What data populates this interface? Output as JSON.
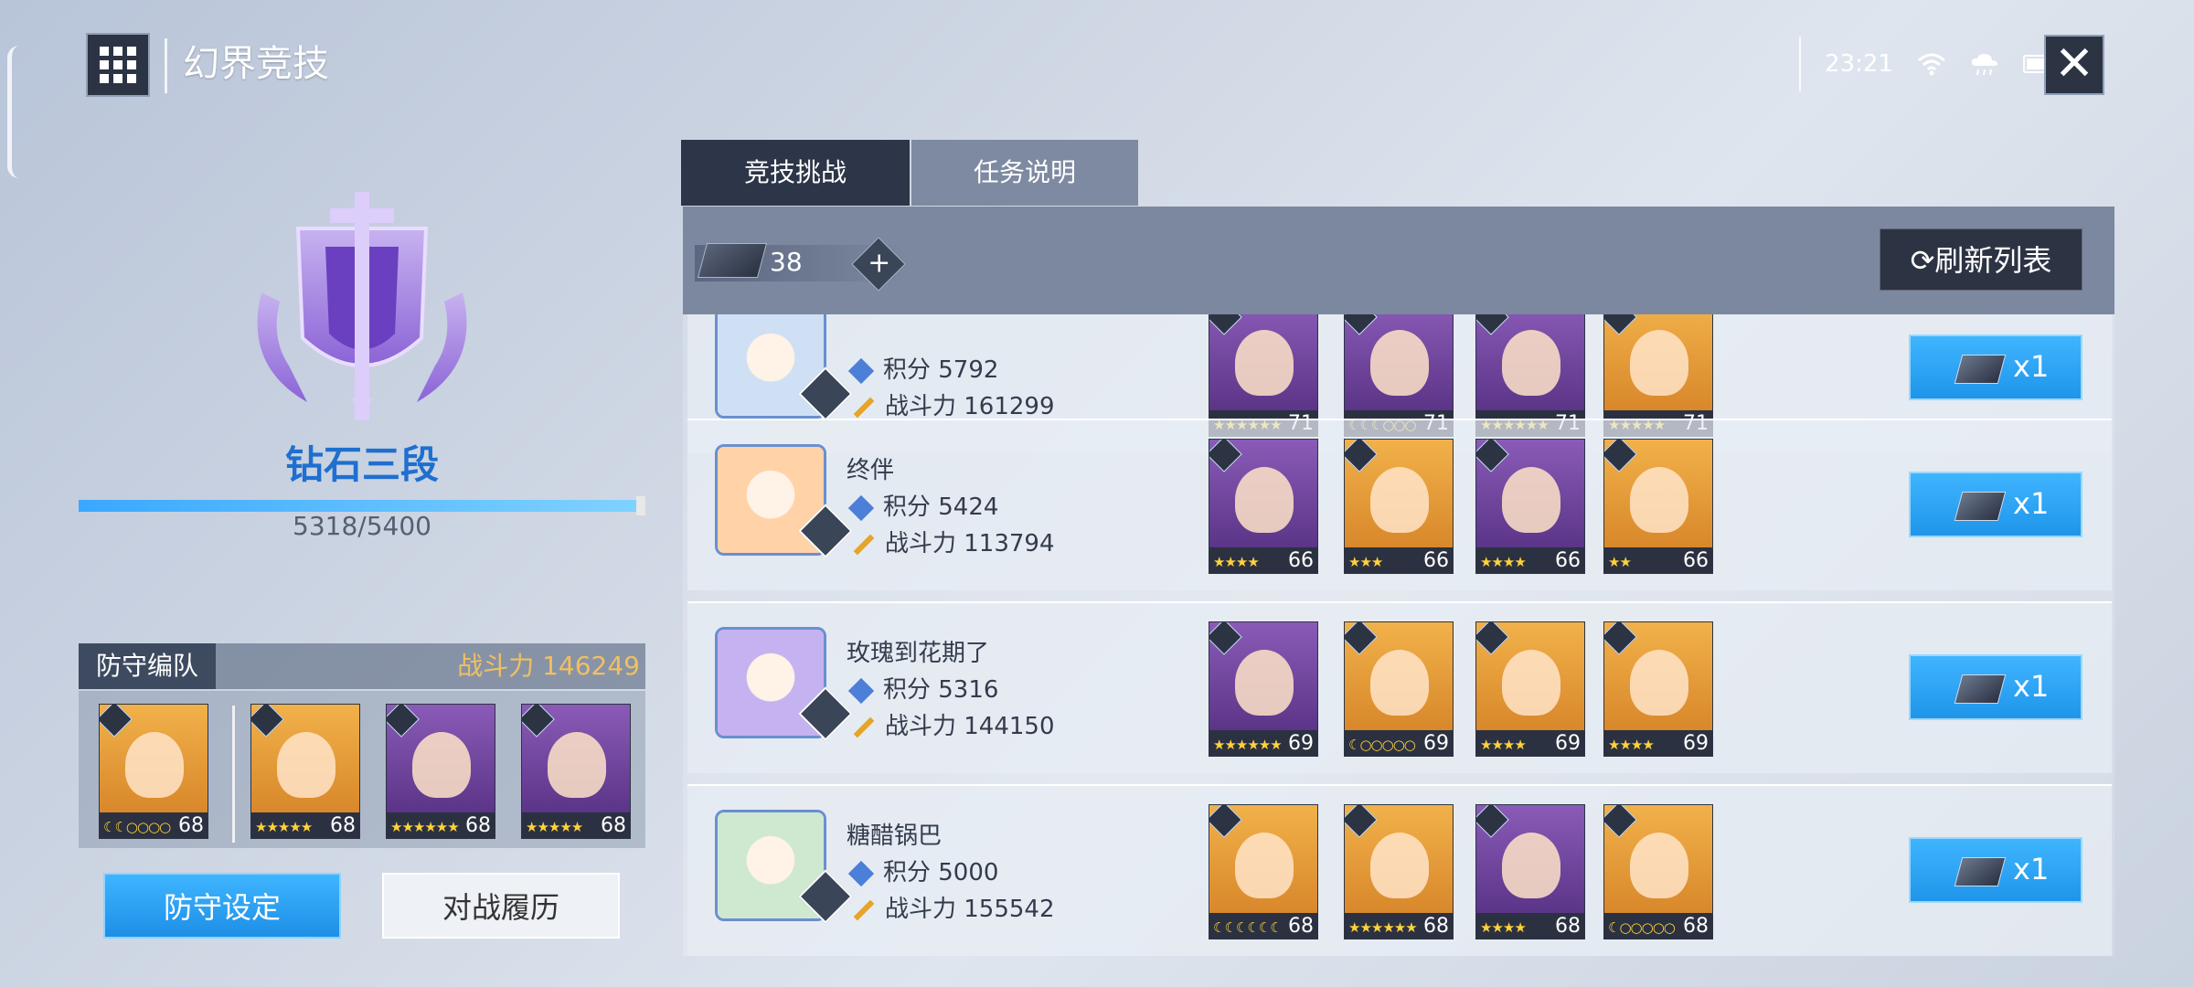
{
  "header": {
    "title": "幻界竞技",
    "time": "23:21"
  },
  "icons": {
    "menu": "grid-menu-icon",
    "close": "close-icon",
    "wifi": "wifi-icon",
    "weather": "weather-icon",
    "battery": "battery-icon"
  },
  "rank": {
    "name": "钻石三段",
    "score_text": "5318/5400",
    "progress": 0.985
  },
  "defense": {
    "title": "防守编队",
    "power_text": "战斗力 146249",
    "heroes": [
      {
        "level": "68",
        "stars": "☾☾○○○○",
        "bg": "orange"
      },
      {
        "level": "68",
        "stars": "★★★★★",
        "bg": "orange"
      },
      {
        "level": "68",
        "stars": "★★★★★★",
        "bg": "purple"
      },
      {
        "level": "68",
        "stars": "★★★★★",
        "bg": "purple"
      }
    ]
  },
  "buttons": {
    "defense_setup": "防守设定",
    "battle_history": "对战履历",
    "refresh": "刷新列表"
  },
  "tabs": [
    {
      "label": "竞技挑战",
      "active": true
    },
    {
      "label": "任务说明",
      "active": false
    }
  ],
  "tickets": {
    "count": "38",
    "plus": "+"
  },
  "opponents": [
    {
      "name": "",
      "score": "积分 5792",
      "power": "战斗力 161299",
      "reward": "x1",
      "heroes": [
        {
          "level": "71",
          "stars": "★★★★★★",
          "bg": "purple"
        },
        {
          "level": "71",
          "stars": "☾☾☾○○○",
          "bg": "purple"
        },
        {
          "level": "71",
          "stars": "★★★★★★",
          "bg": "purple"
        },
        {
          "level": "71",
          "stars": "★★★★★",
          "bg": "orange"
        }
      ]
    },
    {
      "name": "终伴",
      "score": "积分 5424",
      "power": "战斗力 113794",
      "reward": "x1",
      "heroes": [
        {
          "level": "66",
          "stars": "★★★★",
          "bg": "purple"
        },
        {
          "level": "66",
          "stars": "★★★",
          "bg": "orange"
        },
        {
          "level": "66",
          "stars": "★★★★",
          "bg": "purple"
        },
        {
          "level": "66",
          "stars": "★★",
          "bg": "orange"
        }
      ]
    },
    {
      "name": "玫瑰到花期了",
      "score": "积分 5316",
      "power": "战斗力 144150",
      "reward": "x1",
      "heroes": [
        {
          "level": "69",
          "stars": "★★★★★★",
          "bg": "purple"
        },
        {
          "level": "69",
          "stars": "☾○○○○○",
          "bg": "orange"
        },
        {
          "level": "69",
          "stars": "★★★★",
          "bg": "orange"
        },
        {
          "level": "69",
          "stars": "★★★★",
          "bg": "orange"
        }
      ]
    },
    {
      "name": "糖醋锅巴",
      "score": "积分 5000",
      "power": "战斗力 155542",
      "reward": "x1",
      "heroes": [
        {
          "level": "68",
          "stars": "☾☾☾☾☾☾",
          "bg": "orange"
        },
        {
          "level": "68",
          "stars": "★★★★★★",
          "bg": "orange"
        },
        {
          "level": "68",
          "stars": "★★★★",
          "bg": "purple"
        },
        {
          "level": "68",
          "stars": "☾○○○○○",
          "bg": "orange"
        }
      ]
    }
  ]
}
